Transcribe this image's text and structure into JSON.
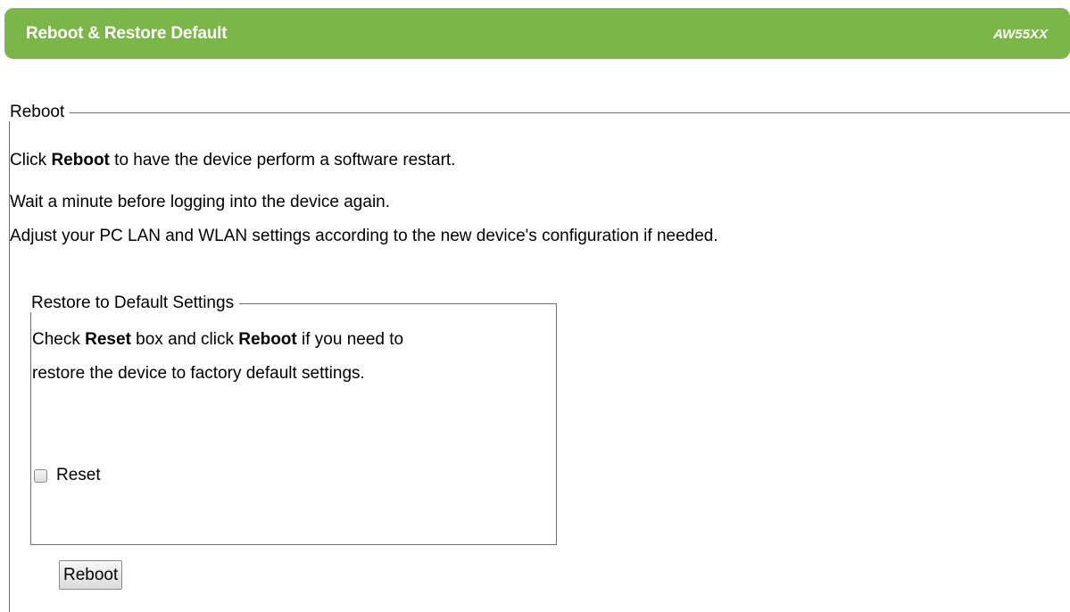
{
  "header": {
    "title": "Reboot & Restore Default",
    "model": "AW55XX"
  },
  "reboot_section": {
    "legend": "Reboot",
    "line1_prefix": "Click ",
    "line1_bold": "Reboot",
    "line1_suffix": " to have the device perform a software restart.",
    "line2": "Wait a minute before logging into the device again.",
    "line3": "Adjust your PC LAN and WLAN settings according to the new device's configuration if needed."
  },
  "restore_section": {
    "legend": "Restore to Default Settings",
    "line1_prefix": "Check ",
    "line1_bold1": "Reset",
    "line1_mid": " box and click ",
    "line1_bold2": "Reboot",
    "line1_suffix": " if you need to",
    "line2": "restore the device to factory default settings.",
    "checkbox_label": "Reset",
    "checkbox_checked": false
  },
  "actions": {
    "reboot_button_label": "Reboot"
  },
  "colors": {
    "header_bg": "#7ab648",
    "header_text": "#ffffff"
  }
}
